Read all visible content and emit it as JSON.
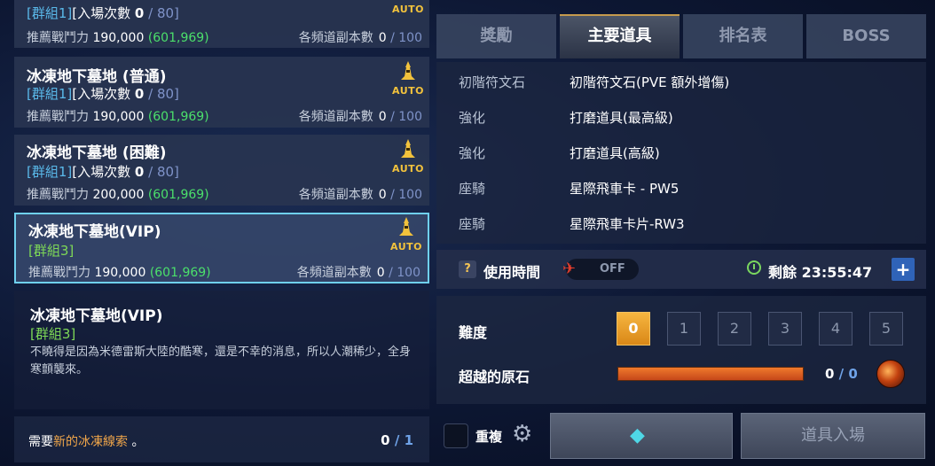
{
  "dungeon_list": [
    {
      "title": "",
      "group": "[群組1]",
      "entry_label": "[入場次數",
      "entry_count": "0",
      "entry_max": "80]",
      "power_label": "推薦戰鬥力",
      "power": "190,000",
      "power_current": "(601,969)",
      "runs_label": "各頻道副本數",
      "runs": "0",
      "runs_max": "100",
      "auto_label": "AUTO"
    },
    {
      "title": "冰凍地下墓地 (普通)",
      "group": "[群組1]",
      "entry_label": "[入場次數",
      "entry_count": "0",
      "entry_max": "80]",
      "power_label": "推薦戰鬥力",
      "power": "190,000",
      "power_current": "(601,969)",
      "runs_label": "各頻道副本數",
      "runs": "0",
      "runs_max": "100",
      "auto_label": "AUTO"
    },
    {
      "title": "冰凍地下墓地 (困難)",
      "group": "[群組1]",
      "entry_label": "[入場次數",
      "entry_count": "0",
      "entry_max": "80]",
      "power_label": "推薦戰鬥力",
      "power": "200,000",
      "power_current": "(601,969)",
      "runs_label": "各頻道副本數",
      "runs": "0",
      "runs_max": "100",
      "auto_label": "AUTO"
    },
    {
      "title": "冰凍地下墓地(VIP)",
      "group": "[群組3]",
      "power_label": "推薦戰鬥力",
      "power": "190,000",
      "power_current": "(601,969)",
      "runs_label": "各頻道副本數",
      "runs": "0",
      "runs_max": "100",
      "auto_label": "AUTO"
    }
  ],
  "detail": {
    "title": "冰凍地下墓地(VIP)",
    "group": "[群組3]",
    "description": "不曉得是因為米德雷斯大陸的酷寒，還是不幸的消息，所以人潮稀少，全身寒顫襲來。"
  },
  "requirement": {
    "prefix": "需要",
    "item": "新的冰凍線索",
    "suffix": " 。",
    "have": "0",
    "need": "1"
  },
  "tabs": [
    {
      "label": "獎勵",
      "active": false
    },
    {
      "label": "主要道具",
      "active": true
    },
    {
      "label": "排名表",
      "active": false
    },
    {
      "label": "BOSS",
      "active": false
    }
  ],
  "rewards": [
    {
      "category": "初階符文石",
      "item": "初階符文石(PVE 額外增傷)"
    },
    {
      "category": "強化",
      "item": "打磨道具(最高級)"
    },
    {
      "category": "強化",
      "item": "打磨道具(高級)"
    },
    {
      "category": "座騎",
      "item": "星際飛車卡 - PW5"
    },
    {
      "category": "座騎",
      "item": "星際飛車卡片-RW3"
    }
  ],
  "usage": {
    "help": "?",
    "label": "使用時間",
    "toggle": "OFF",
    "remaining": "剩餘 23:55:47",
    "plus": "+"
  },
  "difficulty": {
    "label": "難度",
    "levels": [
      "0",
      "1",
      "2",
      "3",
      "4",
      "5"
    ],
    "selected": 0
  },
  "stone": {
    "label": "超越的原石",
    "have": "0",
    "need": "0",
    "fill_fraction": 1.0
  },
  "footer": {
    "repeat_label": "重複",
    "enter_label": "道具入場"
  },
  "colors": {
    "accent_gold": "#f2c23c",
    "power_green": "#4be06b",
    "group_blue": "#5ab9ea",
    "group_green": "#7ed957",
    "requirement_orange": "#f0a64a",
    "selected_border": "#6fd0ee"
  },
  "icons": {
    "auto": "tower-auto-icon",
    "help": "question-icon",
    "vehicle": "helicopter-icon",
    "clock": "clock-icon",
    "plus": "plus-icon",
    "orb": "fire-orb-icon",
    "gear": "gear-icon",
    "gem": "gem-icon"
  }
}
